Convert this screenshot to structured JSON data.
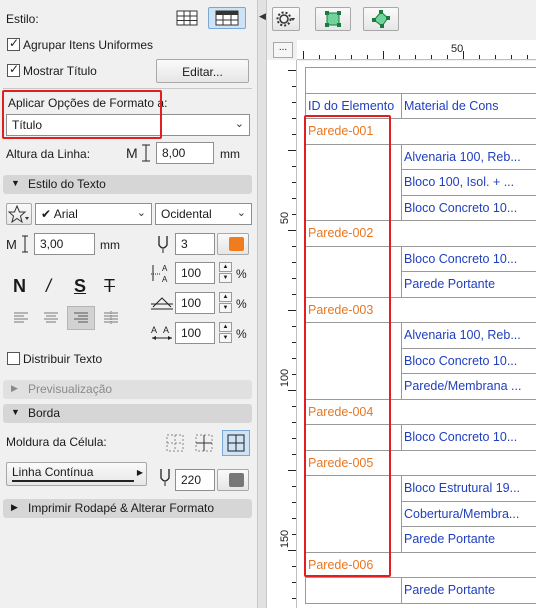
{
  "left_panel": {
    "style_label": "Estilo:",
    "group_items_label": "Agrupar Itens Uniformes",
    "group_items_checked": true,
    "show_title_label": "Mostrar Título",
    "show_title_checked": true,
    "edit_button": "Editar...",
    "apply_format_label": "Aplicar Opções de Formato a:",
    "apply_format_value": "Título",
    "row_height_label": "Altura da Linha:",
    "row_height_value": "8,00",
    "row_height_unit": "mm",
    "text_style_section": "Estilo do Texto",
    "font_value": "Arial",
    "script_value": "Ocidental",
    "font_size_value": "3,00",
    "font_size_unit": "mm",
    "pen_value": "3",
    "pen_color": "#f07c1e",
    "bold_label": "N",
    "italic_label": "/",
    "underline_label": "S",
    "strike_label": "T",
    "width_factor_value": "100",
    "spacing_factor_value": "100",
    "char_spacing_value": "100",
    "percent_symbol": "%",
    "distribute_text_label": "Distribuir Texto",
    "distribute_text_checked": false,
    "preview_section": "Previsualização",
    "border_section": "Borda",
    "cell_frame_label": "Moldura da Célula:",
    "line_type_value": "Linha Contínua",
    "border_pen_value": "220",
    "print_footer_section": "Imprimir Rodapé & Alterar Formato"
  },
  "toolbar": {
    "settings_icon": "gear-icon",
    "frame_icon": "frame-square-icon",
    "frame_rotate_icon": "frame-rotate-icon"
  },
  "ruler": {
    "corner_label": "...",
    "top_marks": [
      "50"
    ],
    "left_marks": [
      "50",
      "100",
      "150"
    ]
  },
  "table": {
    "headers": [
      "ID do Elemento",
      "Material de Constr"
    ],
    "rows": [
      {
        "id": "Parede-001",
        "materials": [
          "Alvenaria 100, Reb...",
          "Bloco 100, Isol. + ...",
          "Bloco Concreto 10..."
        ]
      },
      {
        "id": "Parede-002",
        "materials": [
          "Bloco Concreto 10...",
          "Parede Portante"
        ]
      },
      {
        "id": "Parede-003",
        "materials": [
          "Alvenaria 100, Reb...",
          "Bloco Concreto 10...",
          "Parede/Membrana ..."
        ]
      },
      {
        "id": "Parede-004",
        "materials": [
          "Bloco Concreto 10..."
        ]
      },
      {
        "id": "Parede-005",
        "materials": [
          "Bloco Estrutural 19...",
          "Cobertura/Membra...",
          "Parede Portante"
        ]
      },
      {
        "id": "Parede-006",
        "materials": [
          "Parede Portante"
        ]
      }
    ],
    "header_color": "#1f3fbf",
    "id_color": "#e87722",
    "highlight_color": "#e02020"
  }
}
